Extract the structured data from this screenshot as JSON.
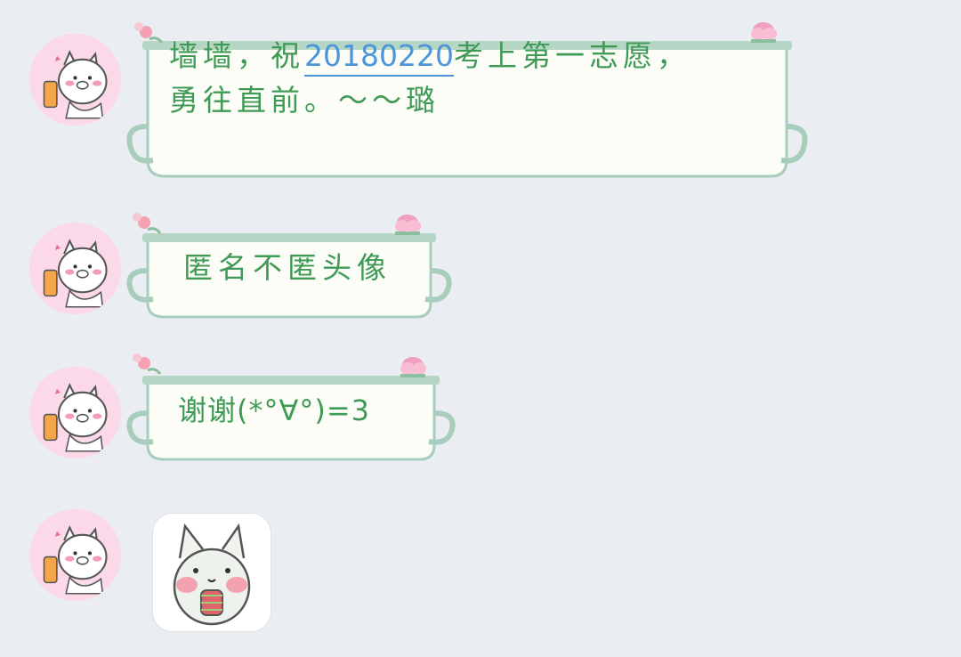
{
  "messages": [
    {
      "text_part1": "墙墙，祝",
      "date_link": "20180220",
      "text_part2": "考上第一志愿，",
      "text_line2": "勇往直前。～～璐"
    },
    {
      "text": "匿名不匿头像"
    },
    {
      "text": "谢谢(*°∀°)=3"
    },
    {
      "type": "sticker",
      "sticker_icon": "kitten-sticker-icon"
    }
  ],
  "colors": {
    "background": "#eaedf1",
    "bubble_text": "#3f9a56",
    "link": "#4c95d9",
    "bubble_border": "#a9cdbd",
    "bubble_fill": "#fdfdf8",
    "avatar_bg": "#fbd9e8"
  }
}
